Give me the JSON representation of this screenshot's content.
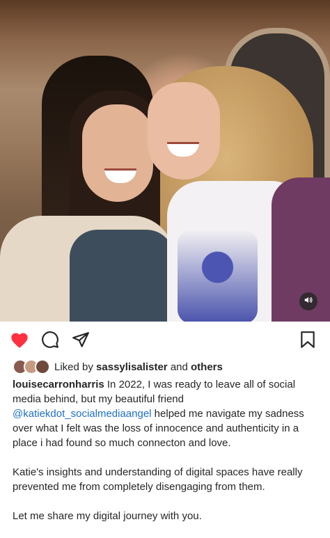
{
  "post": {
    "photo_alt": "",
    "liked": true,
    "colors": {
      "like_red": "#ff3040",
      "mention_blue": "#1f6fc5",
      "text": "#262626"
    }
  },
  "actions": {
    "like_icon": "heart-filled-icon",
    "comment_icon": "comment-icon",
    "share_icon": "send-icon",
    "save_icon": "bookmark-icon",
    "sound_icon": "speaker-icon"
  },
  "likes": {
    "prefix": "Liked by",
    "user": "sassylisalister",
    "middle": "and",
    "others": "others"
  },
  "caption": {
    "username": "louisecarronharris",
    "text_1": " In 2022, I was ready to leave all of social media behind, but my beautiful friend ",
    "mention": "@katiekdot_socialmediaangel",
    "text_2": " helped me navigate my sadness over what I felt was the loss of innocence and authenticity in a place i had found so much connecton and love.",
    "paragraph_2": "Katie's insights and understanding of digital spaces have really prevented me from completely disengaging from them.",
    "paragraph_3": "Let me share my digital journey with you."
  }
}
